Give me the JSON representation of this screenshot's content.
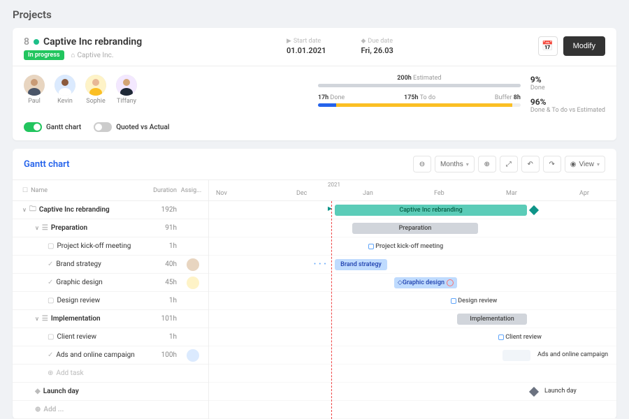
{
  "page_title": "Projects",
  "project": {
    "number": "8",
    "name": "Captive Inc rebranding",
    "status_label": "In progress",
    "client": "Captive Inc.",
    "start_label": "Start date",
    "start_value": "01.01.2021",
    "due_label": "Due date",
    "due_value": "Fri, 26.03",
    "modify_label": "Modify"
  },
  "people": [
    {
      "name": "Paul"
    },
    {
      "name": "Kevin"
    },
    {
      "name": "Sophie"
    },
    {
      "name": "Tiffany"
    }
  ],
  "stats": {
    "estimated_h": "200h",
    "estimated_label": "Estimated",
    "done_h": "17h",
    "done_label": "Done",
    "todo_h": "175h",
    "todo_label": "To do",
    "buffer_label": "Buffer",
    "buffer_h": "8h",
    "pct_done": "9%",
    "pct_done_label": "Done",
    "pct_combo": "96%",
    "pct_combo_label": "Done & To do vs Estimated"
  },
  "toggles": {
    "gantt_label": "Gantt chart",
    "qva_label": "Quoted vs Actual"
  },
  "gantt": {
    "title": "Gantt chart",
    "months_label": "Months",
    "view_label": "View",
    "cols": {
      "name": "Name",
      "duration": "Duration",
      "assignee": "Assig..."
    },
    "year_label": "2021",
    "months": [
      "Nov",
      "Dec",
      "Jan",
      "Feb",
      "Mar",
      "Apr"
    ],
    "rows": [
      {
        "name": "Captive Inc rebranding",
        "dur": "192h",
        "indent": 0,
        "kind": "summary"
      },
      {
        "name": "Preparation",
        "dur": "91h",
        "indent": 1,
        "kind": "group"
      },
      {
        "name": "Project kick-off meeting",
        "dur": "1h",
        "indent": 2,
        "kind": "task"
      },
      {
        "name": "Brand strategy",
        "dur": "40h",
        "indent": 2,
        "kind": "task",
        "has_av": true
      },
      {
        "name": "Graphic design",
        "dur": "45h",
        "indent": 2,
        "kind": "task",
        "has_av": true
      },
      {
        "name": "Design review",
        "dur": "1h",
        "indent": 2,
        "kind": "task"
      },
      {
        "name": "Implementation",
        "dur": "101h",
        "indent": 1,
        "kind": "group"
      },
      {
        "name": "Client review",
        "dur": "1h",
        "indent": 2,
        "kind": "task"
      },
      {
        "name": "Ads and online campaign",
        "dur": "100h",
        "indent": 2,
        "kind": "task",
        "has_av": true
      },
      {
        "name": "Add task",
        "dur": "",
        "indent": 2,
        "kind": "add"
      },
      {
        "name": "Launch day",
        "dur": "",
        "indent": 1,
        "kind": "milestone"
      },
      {
        "name": "Add ...",
        "dur": "",
        "indent": 1,
        "kind": "add"
      }
    ],
    "bars": {
      "summary": "Captive Inc rebranding",
      "prep": "Preparation",
      "kickoff": "Project kick-off meeting",
      "brand": "Brand strategy",
      "graphic": "Graphic design",
      "review": "Design review",
      "impl": "Implementation",
      "client": "Client review",
      "ads": "Ads and online campaign",
      "launch": "Launch day"
    }
  },
  "colors": {
    "green": "#22c55e",
    "teal": "#5bccb8",
    "blue": "#2563eb",
    "yellow": "#fbbf24",
    "grey": "#d1d5db",
    "lightblue": "#bfdbfe"
  }
}
